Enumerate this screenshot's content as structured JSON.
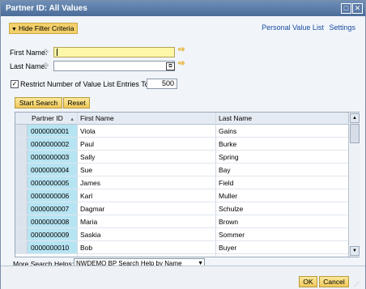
{
  "window": {
    "title": "Partner ID: All Values"
  },
  "filter": {
    "hide_label": "Hide Filter Criteria",
    "links": [
      "Personal Value List",
      "Settings"
    ],
    "first_name_label": "First Name:",
    "first_name_value": "",
    "last_name_label": "Last Name:",
    "last_name_value": "",
    "restrict_label": "Restrict Number of Value List Entries To",
    "restrict_checked": true,
    "restrict_value": "500",
    "start_search": "Start Search",
    "reset": "Reset"
  },
  "table": {
    "columns": [
      "Partner ID",
      "First Name",
      "Last Name"
    ],
    "sort_indicator": "▲",
    "rows": [
      {
        "id": "0000000001",
        "first": "Viola",
        "last": "Gains"
      },
      {
        "id": "0000000002",
        "first": "Paul",
        "last": "Burke"
      },
      {
        "id": "0000000003",
        "first": "Sally",
        "last": "Spring"
      },
      {
        "id": "0000000004",
        "first": "Sue",
        "last": "Bay"
      },
      {
        "id": "0000000005",
        "first": "James",
        "last": "Field"
      },
      {
        "id": "0000000006",
        "first": "Karl",
        "last": "Muller"
      },
      {
        "id": "0000000007",
        "first": "Dagmar",
        "last": "Schulze"
      },
      {
        "id": "0000000008",
        "first": "Maria",
        "last": "Brown"
      },
      {
        "id": "0000000009",
        "first": "Saskia",
        "last": "Sommer"
      },
      {
        "id": "0000000010",
        "first": "Bob",
        "last": "Buyer"
      }
    ]
  },
  "search_helps": {
    "label": "More Search Helps:",
    "selected": "NWDEMO BP Search Help by Name"
  },
  "footer": {
    "ok": "OK",
    "cancel": "Cancel"
  },
  "colors": {
    "title_bar": "#4f709c",
    "button": "#f0c85a",
    "id_cell": "#b7e4f2",
    "input_highlight": "#fff7a8"
  }
}
